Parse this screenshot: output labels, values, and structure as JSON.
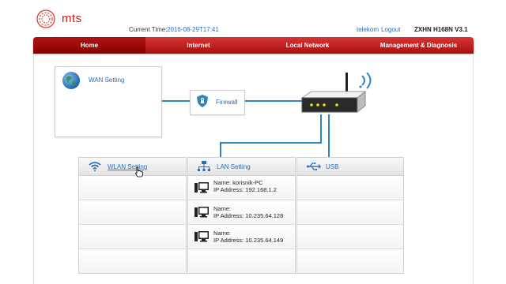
{
  "header": {
    "brand": "mts",
    "current_time_label": "Current Time:",
    "current_time_value": "2016-08-29T17:41",
    "user": "telekom",
    "logout": "Logout",
    "model": "ZXHN H168N V3.1"
  },
  "nav": {
    "tabs": [
      {
        "label": "Home",
        "active": true
      },
      {
        "label": "Internet"
      },
      {
        "label": "Local Network"
      },
      {
        "label": "Management & Diagnosis"
      }
    ]
  },
  "topology": {
    "wan": {
      "label": "WAN Setting",
      "icon": "globe-icon"
    },
    "firewall": {
      "label": "Firewall",
      "icon": "shield-icon"
    },
    "router": {
      "icon": "router-icon"
    }
  },
  "panels": {
    "wlan": {
      "title": "WLAN Setting",
      "icon": "wifi-icon"
    },
    "lan": {
      "title": "LAN Setting",
      "icon": "network-icon",
      "devices": [
        {
          "name": "Name: korisnik-PC",
          "ip": "IP Address: 192.168.1.2"
        },
        {
          "name": "Name:",
          "ip": "IP Address: 10.235.64.128"
        },
        {
          "name": "Name:",
          "ip": "IP Address: 10.235.64.149"
        }
      ]
    },
    "usb": {
      "title": "USB",
      "icon": "usb-icon"
    }
  },
  "colors": {
    "brand_red": "#cc1b1b",
    "link_blue": "#2a6ebb",
    "line_blue": "#2e86c1"
  }
}
